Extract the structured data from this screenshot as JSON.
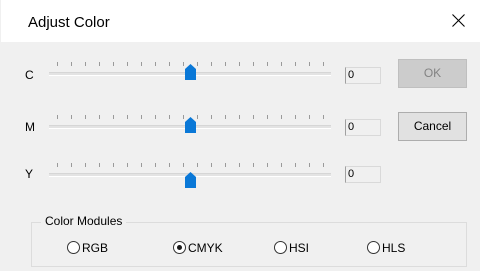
{
  "dialog": {
    "title": "Adjust Color",
    "close_icon": "close-icon"
  },
  "channels": [
    {
      "label": "C",
      "value": "0",
      "level_percent": 50
    },
    {
      "label": "M",
      "value": "0",
      "level_percent": 50
    },
    {
      "label": "Y",
      "value": "0",
      "level_percent": 50
    }
  ],
  "buttons": {
    "ok_label": "OK",
    "ok_enabled": false,
    "cancel_label": "Cancel"
  },
  "color_modules": {
    "group_label": "Color Modules",
    "options": [
      {
        "label": "RGB",
        "selected": false
      },
      {
        "label": "CMYK",
        "selected": true
      },
      {
        "label": "HSI",
        "selected": false
      },
      {
        "label": "HLS",
        "selected": false
      }
    ]
  },
  "colors": {
    "thumb": "#0a78d7",
    "window_bg": "#f0f0f0",
    "titlebar_bg": "#ffffff"
  }
}
